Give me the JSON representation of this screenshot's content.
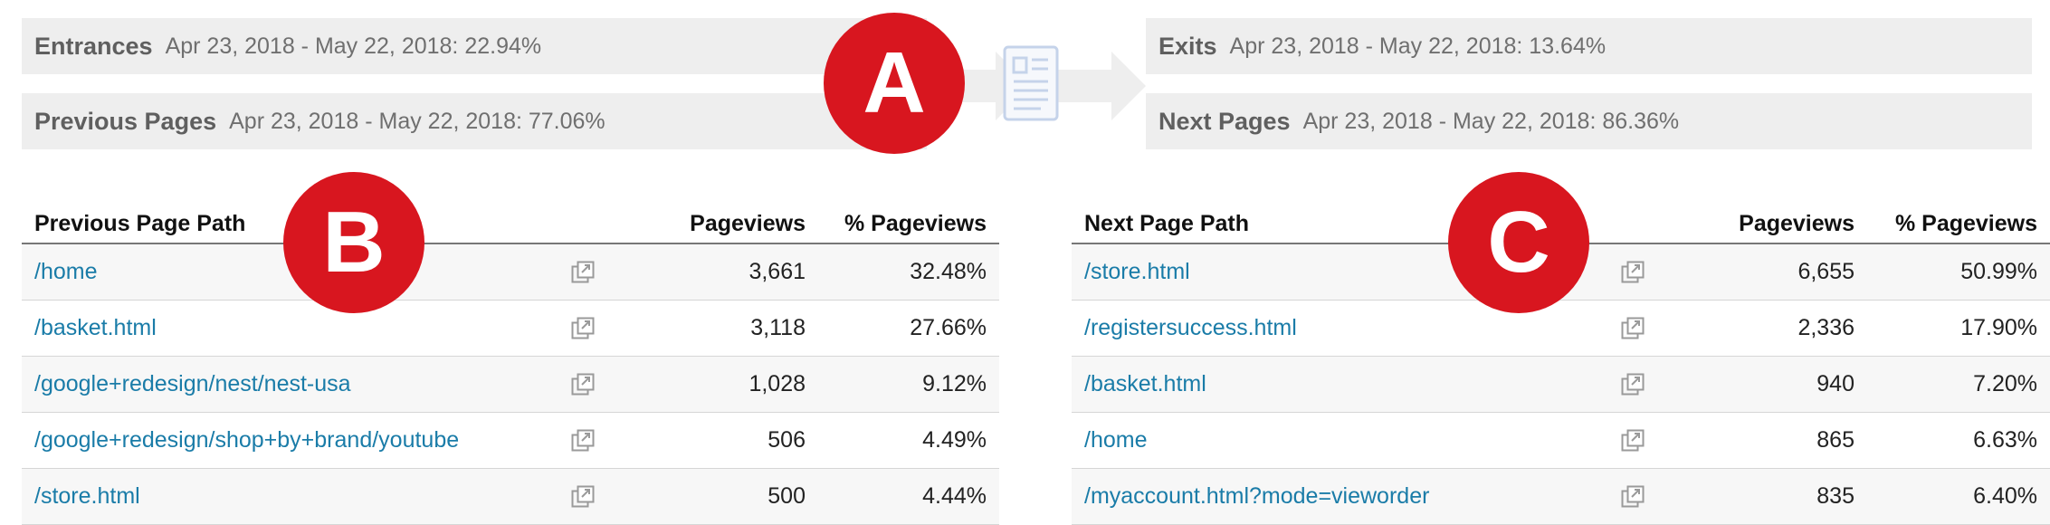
{
  "summary": {
    "entrances": {
      "label": "Entrances",
      "value": "Apr 23, 2018 - May 22, 2018: 22.94%"
    },
    "previous_pages": {
      "label": "Previous Pages",
      "value": "Apr 23, 2018 - May 22, 2018: 77.06%"
    },
    "exits": {
      "label": "Exits",
      "value": "Apr 23, 2018 - May 22, 2018: 13.64%"
    },
    "next_pages": {
      "label": "Next Pages",
      "value": "Apr 23, 2018 - May 22, 2018: 86.36%"
    }
  },
  "badges": {
    "a": "A",
    "b": "B",
    "c": "C"
  },
  "badge_color": "#d8161f",
  "link_color": "#1a7ca8",
  "previous_table": {
    "headers": {
      "path": "Previous Page Path",
      "pageviews": "Pageviews",
      "pct": "% Pageviews"
    },
    "rows": [
      {
        "path": "/home",
        "pageviews": "3,661",
        "pct": "32.48%"
      },
      {
        "path": "/basket.html",
        "pageviews": "3,118",
        "pct": "27.66%"
      },
      {
        "path": "/google+redesign/nest/nest-usa",
        "pageviews": "1,028",
        "pct": "9.12%"
      },
      {
        "path": "/google+redesign/shop+by+brand/youtube",
        "pageviews": "506",
        "pct": "4.49%"
      },
      {
        "path": "/store.html",
        "pageviews": "500",
        "pct": "4.44%"
      }
    ]
  },
  "next_table": {
    "headers": {
      "path": "Next Page Path",
      "pageviews": "Pageviews",
      "pct": "% Pageviews"
    },
    "rows": [
      {
        "path": "/store.html",
        "pageviews": "6,655",
        "pct": "50.99%"
      },
      {
        "path": "/registersuccess.html",
        "pageviews": "2,336",
        "pct": "17.90%"
      },
      {
        "path": "/basket.html",
        "pageviews": "940",
        "pct": "7.20%"
      },
      {
        "path": "/home",
        "pageviews": "865",
        "pct": "6.63%"
      },
      {
        "path": "/myaccount.html?mode=vieworder",
        "pageviews": "835",
        "pct": "6.40%"
      }
    ]
  }
}
